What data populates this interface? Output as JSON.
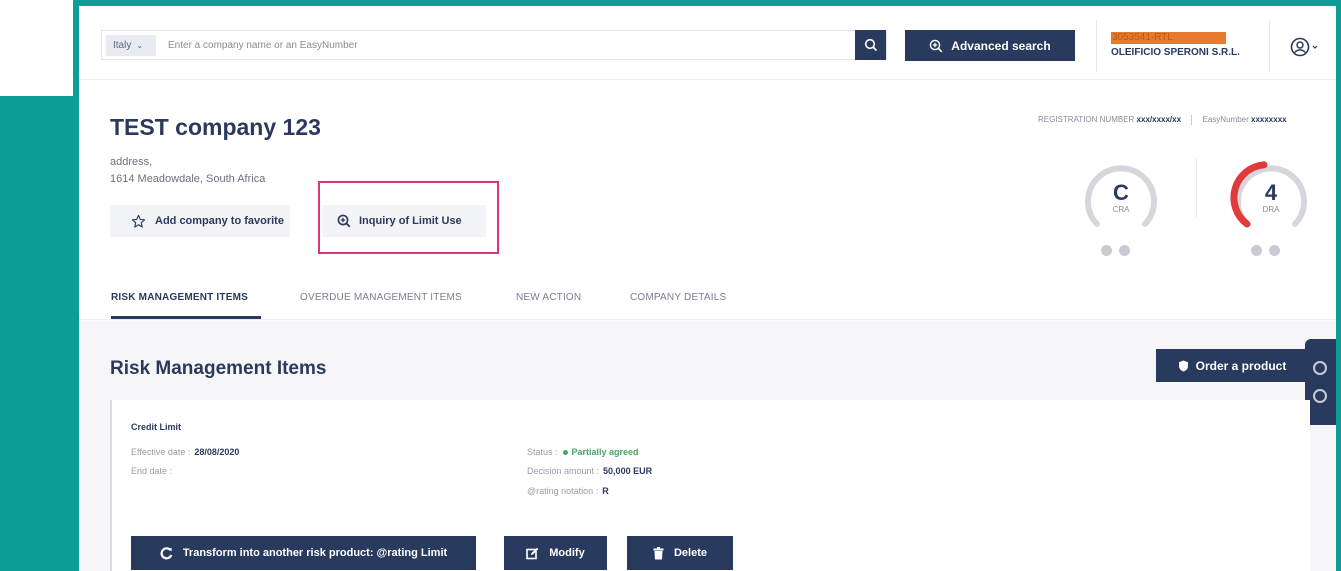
{
  "header": {
    "country": "Italy",
    "search_placeholder": "Enter a company name or an EasyNumber",
    "advanced_search_label": "Advanced search",
    "account_code": "3053541-RTL",
    "account_name": "OLEIFICIO SPERONI S.R.L."
  },
  "company": {
    "name": "TEST company 123",
    "address_line1": "address,",
    "address_line2": "1614 Meadowdale, South Africa",
    "favorite_label": "Add company to favorite",
    "inquiry_label": "Inquiry of Limit Use",
    "registration_label": "REGISTRATION NUMBER",
    "registration_value": "xxx/xxxx/xx",
    "easynumber_label": "EasyNumber",
    "easynumber_value": "xxxxxxxx",
    "cra_grade": "C",
    "cra_label": "CRA",
    "dra_grade": "4",
    "dra_label": "DRA"
  },
  "tabs": [
    {
      "label": "RISK MANAGEMENT ITEMS",
      "active": true
    },
    {
      "label": "OVERDUE MANAGEMENT ITEMS",
      "active": false
    },
    {
      "label": "NEW ACTION",
      "active": false
    },
    {
      "label": "COMPANY DETAILS",
      "active": false
    }
  ],
  "risk": {
    "title": "Risk Management Items",
    "order_label": "Order a product",
    "card": {
      "title": "Credit Limit",
      "effective_date_label": "Effective date :",
      "effective_date": "28/08/2020",
      "end_date_label": "End date :",
      "status_label": "Status :",
      "status_value": "Partially agreed",
      "decision_amount_label": "Decision amount :",
      "decision_amount": "50,000 EUR",
      "rating_notation_label": "@rating notation :",
      "rating_notation": "R"
    },
    "actions": {
      "transform_label": "Transform into another risk product: @rating Limit",
      "modify_label": "Modify",
      "delete_label": "Delete"
    }
  },
  "colors": {
    "navy": "#283a5e",
    "teal_frame": "#0e9e95",
    "highlight": "#d9367a",
    "dra_red": "#e03a3a",
    "status_green": "#4aa564"
  }
}
